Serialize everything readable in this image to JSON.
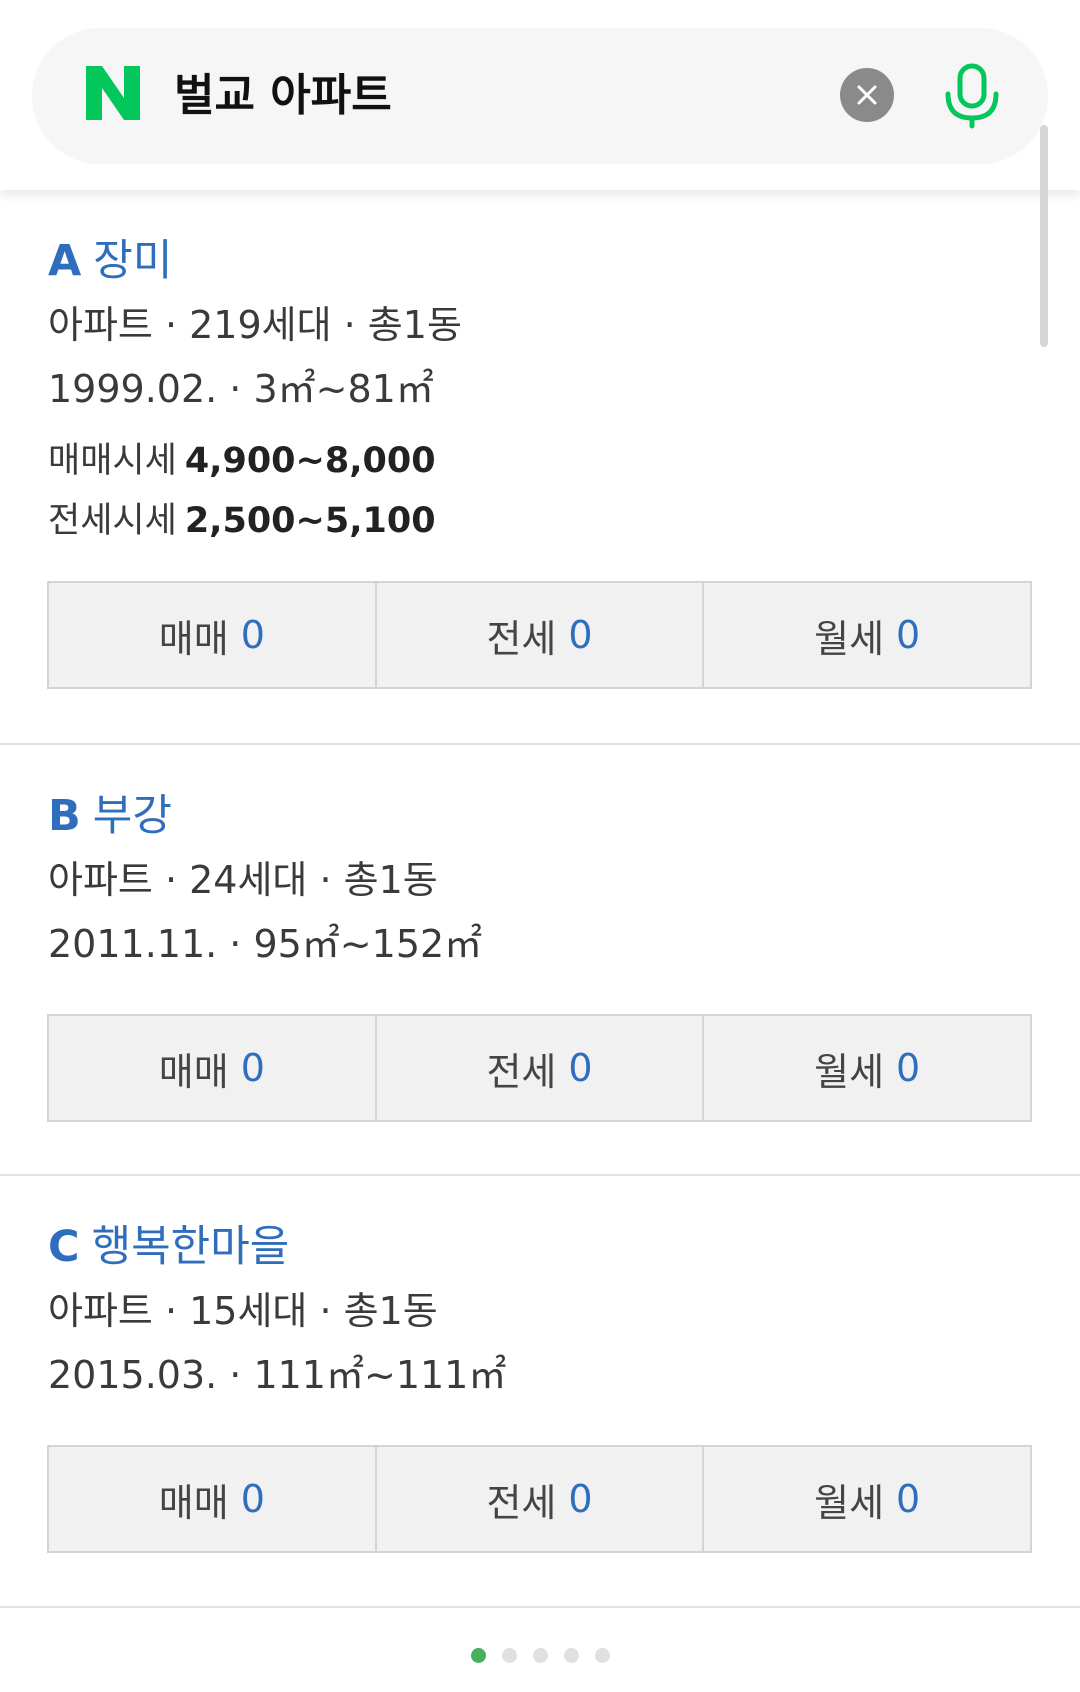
{
  "search": {
    "query": "벌교 아파트",
    "brand_color": "#03c75a",
    "icons": [
      "naver-logo-icon",
      "close-icon",
      "microphone-icon"
    ]
  },
  "cards": [
    {
      "letter": "A",
      "name": "장미",
      "meta_line1": "아파트 · 219세대 · 총1동",
      "meta_line2": "1999.02. · 3㎡~81㎡",
      "sale_label": "매매시세",
      "sale_value": "4,900~8,000",
      "jeonse_label": "전세시세",
      "jeonse_value": "2,500~5,100",
      "buttons": [
        {
          "label": "매매",
          "count": "0"
        },
        {
          "label": "전세",
          "count": "0"
        },
        {
          "label": "월세",
          "count": "0"
        }
      ]
    },
    {
      "letter": "B",
      "name": "부강",
      "meta_line1": "아파트 · 24세대 · 총1동",
      "meta_line2": "2011.11. · 95㎡~152㎡",
      "buttons": [
        {
          "label": "매매",
          "count": "0"
        },
        {
          "label": "전세",
          "count": "0"
        },
        {
          "label": "월세",
          "count": "0"
        }
      ]
    },
    {
      "letter": "C",
      "name": "행복한마을",
      "meta_line1": "아파트 · 15세대 · 총1동",
      "meta_line2": "2015.03. · 111㎡~111㎡",
      "buttons": [
        {
          "label": "매매",
          "count": "0"
        },
        {
          "label": "전세",
          "count": "0"
        },
        {
          "label": "월세",
          "count": "0"
        }
      ]
    }
  ],
  "pager": {
    "total_pages": 5,
    "current_page": 1,
    "active_color": "#47b05f"
  },
  "colors": {
    "link_blue": "#2f6dbd",
    "button_bg": "#f1f1f1"
  }
}
